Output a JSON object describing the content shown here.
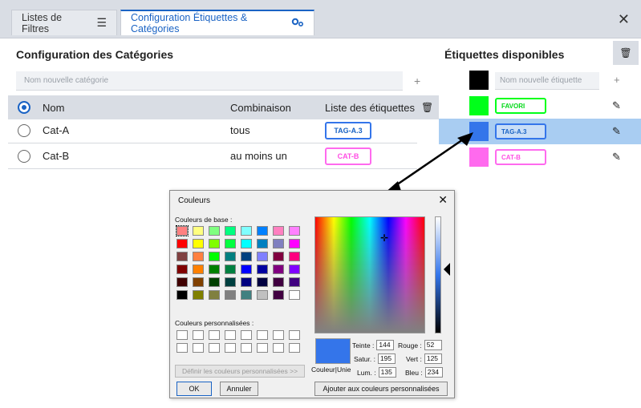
{
  "tabs": {
    "filters_label": "Listes de Filtres",
    "config_label": "Configuration Étiquettes & Catégories"
  },
  "categories": {
    "title": "Configuration des Catégories",
    "new_placeholder": "Nom nouvelle catégorie",
    "add_symbol": "+",
    "headers": {
      "name": "Nom",
      "combination": "Combinaison",
      "tags": "Liste des étiquettes"
    },
    "rows": [
      {
        "name": "Cat-A",
        "combination": "tous",
        "tag": "TAG-A.3"
      },
      {
        "name": "Cat-B",
        "combination": "au moins un",
        "tag": "CAT-B"
      }
    ]
  },
  "tags": {
    "title": "Étiquettes disponibles",
    "new_placeholder": "Nom nouvelle étiquette",
    "add_symbol": "+",
    "items": [
      {
        "label": "FAVORI",
        "color": "#00ff1a"
      },
      {
        "label": "TAG-A.3",
        "color": "#3475ea"
      },
      {
        "label": "CAT-B",
        "color": "#ff6aee"
      }
    ],
    "new_color": "#000000"
  },
  "dialog": {
    "title": "Couleurs",
    "base_colors_label": "Couleurs de base :",
    "custom_colors_label": "Couleurs personnalisées :",
    "define_button": "Définir les couleurs personnalisées >>",
    "ok_button": "OK",
    "cancel_button": "Annuler",
    "add_custom_button": "Ajouter aux couleurs personnalisées",
    "preview_label": "Couleur|Unie",
    "fields": {
      "hue_label": "Teinte :",
      "hue": "144",
      "sat_label": "Satur. :",
      "sat": "195",
      "lum_label": "Lum. :",
      "lum": "135",
      "red_label": "Rouge :",
      "red": "52",
      "green_label": "Vert :",
      "green": "125",
      "blue_label": "Bleu :",
      "blue": "234"
    },
    "base_colors": [
      "#ff8080",
      "#ffff80",
      "#80ff80",
      "#00ff80",
      "#80ffff",
      "#0080ff",
      "#ff80c0",
      "#ff80ff",
      "#ff0000",
      "#ffff00",
      "#80ff00",
      "#00ff40",
      "#00ffff",
      "#0080c0",
      "#8080c0",
      "#ff00ff",
      "#804040",
      "#ff8040",
      "#00ff00",
      "#008080",
      "#004080",
      "#8080ff",
      "#800040",
      "#ff0080",
      "#800000",
      "#ff8000",
      "#008000",
      "#008040",
      "#0000ff",
      "#0000a0",
      "#800080",
      "#8000ff",
      "#400000",
      "#804000",
      "#004000",
      "#004040",
      "#000080",
      "#000040",
      "#400040",
      "#400080",
      "#000000",
      "#808000",
      "#808040",
      "#808080",
      "#408080",
      "#c0c0c0",
      "#400040",
      "#ffffff"
    ]
  }
}
